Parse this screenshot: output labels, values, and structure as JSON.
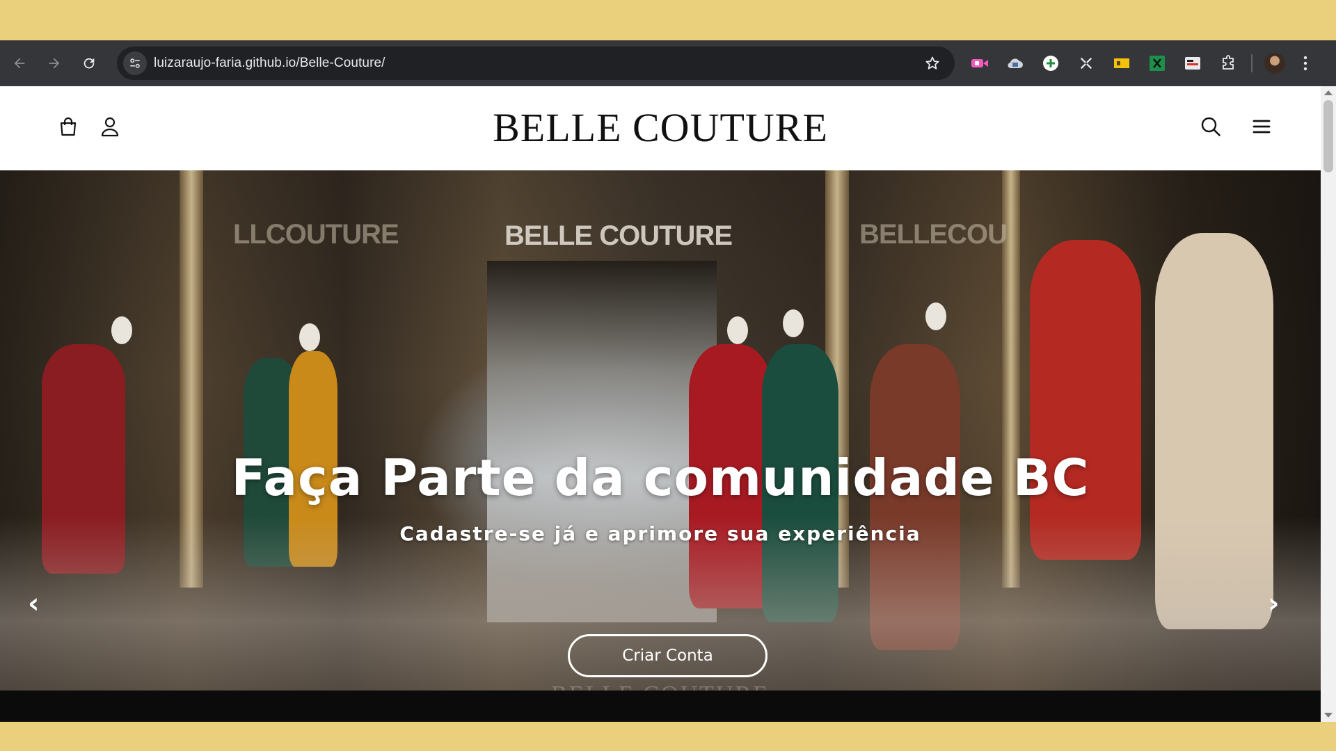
{
  "browser": {
    "url": "luizaraujo-faria.github.io/Belle-Couture/",
    "extensions": [
      "video-extension-icon",
      "cloud-extension-icon",
      "add-circle-extension-icon",
      "fullscreen-extension-icon",
      "yellow-tag-extension-icon",
      "excel-extension-icon",
      "subtitles-extension-icon",
      "puzzle-extensions-icon"
    ]
  },
  "site": {
    "brand": "BELLE COUTURE"
  },
  "hero": {
    "title": "Faça Parte da comunidade BC",
    "subtitle": "Cadastre-se já e aprimore sua experiência",
    "button_label": "Criar Conta",
    "prev_arrow": "‹",
    "next_arrow": "›",
    "sign_center": "BELLE COUTURE",
    "sign_left": "LLCOUTURE",
    "sign_right": "BELLECOU",
    "watermark": "BELLE COUTURE"
  },
  "colors": {
    "desktop_bg": "#ead07c",
    "toolbar": "#35363a",
    "omnibox": "#202124",
    "footer_strip": "#0b0b0b"
  }
}
